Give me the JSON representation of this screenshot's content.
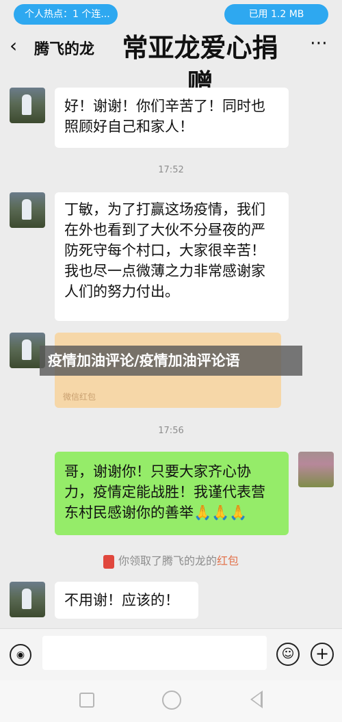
{
  "status": {
    "hotspot": "个人热点：1 个连...",
    "data_used": "已用 1.2 MB"
  },
  "header": {
    "back_icon": "‹",
    "contact_name": "腾飞的龙",
    "more_icon": "⋯"
  },
  "overlay_title": "常亚龙爱心捐赠",
  "messages": {
    "m1": "好！谢谢！你们辛苦了！同时也照顾好自己和家人！",
    "time1": "17:52",
    "m2": "丁敏，为了打赢这场疫情，我们在外也看到了大伙不分昼夜的严防死守每个村口，大家很辛苦！我也尽一点微薄之力非常感谢家人们的努力付出。",
    "redpacket_footer": "微信红包",
    "watermark": "疫情加油评论/疫情加油评论语",
    "time2": "17:56",
    "m3": "哥，谢谢你！只要大家齐心协力，疫情定能战胜！我谨代表营东村民感谢你的善举🙏🙏🙏",
    "sys_prefix": "你领取了腾飞的龙的",
    "sys_link": "红包",
    "m4": "不用谢！应该的！"
  },
  "input": {
    "placeholder": ""
  },
  "colors": {
    "chip": "#2ea8f0",
    "bubble_green": "#95ec69",
    "redpacket": "#f6d7a8"
  },
  "icons": {
    "voice": "voice-icon",
    "emoji": "emoji-icon",
    "plus": "plus-icon"
  }
}
